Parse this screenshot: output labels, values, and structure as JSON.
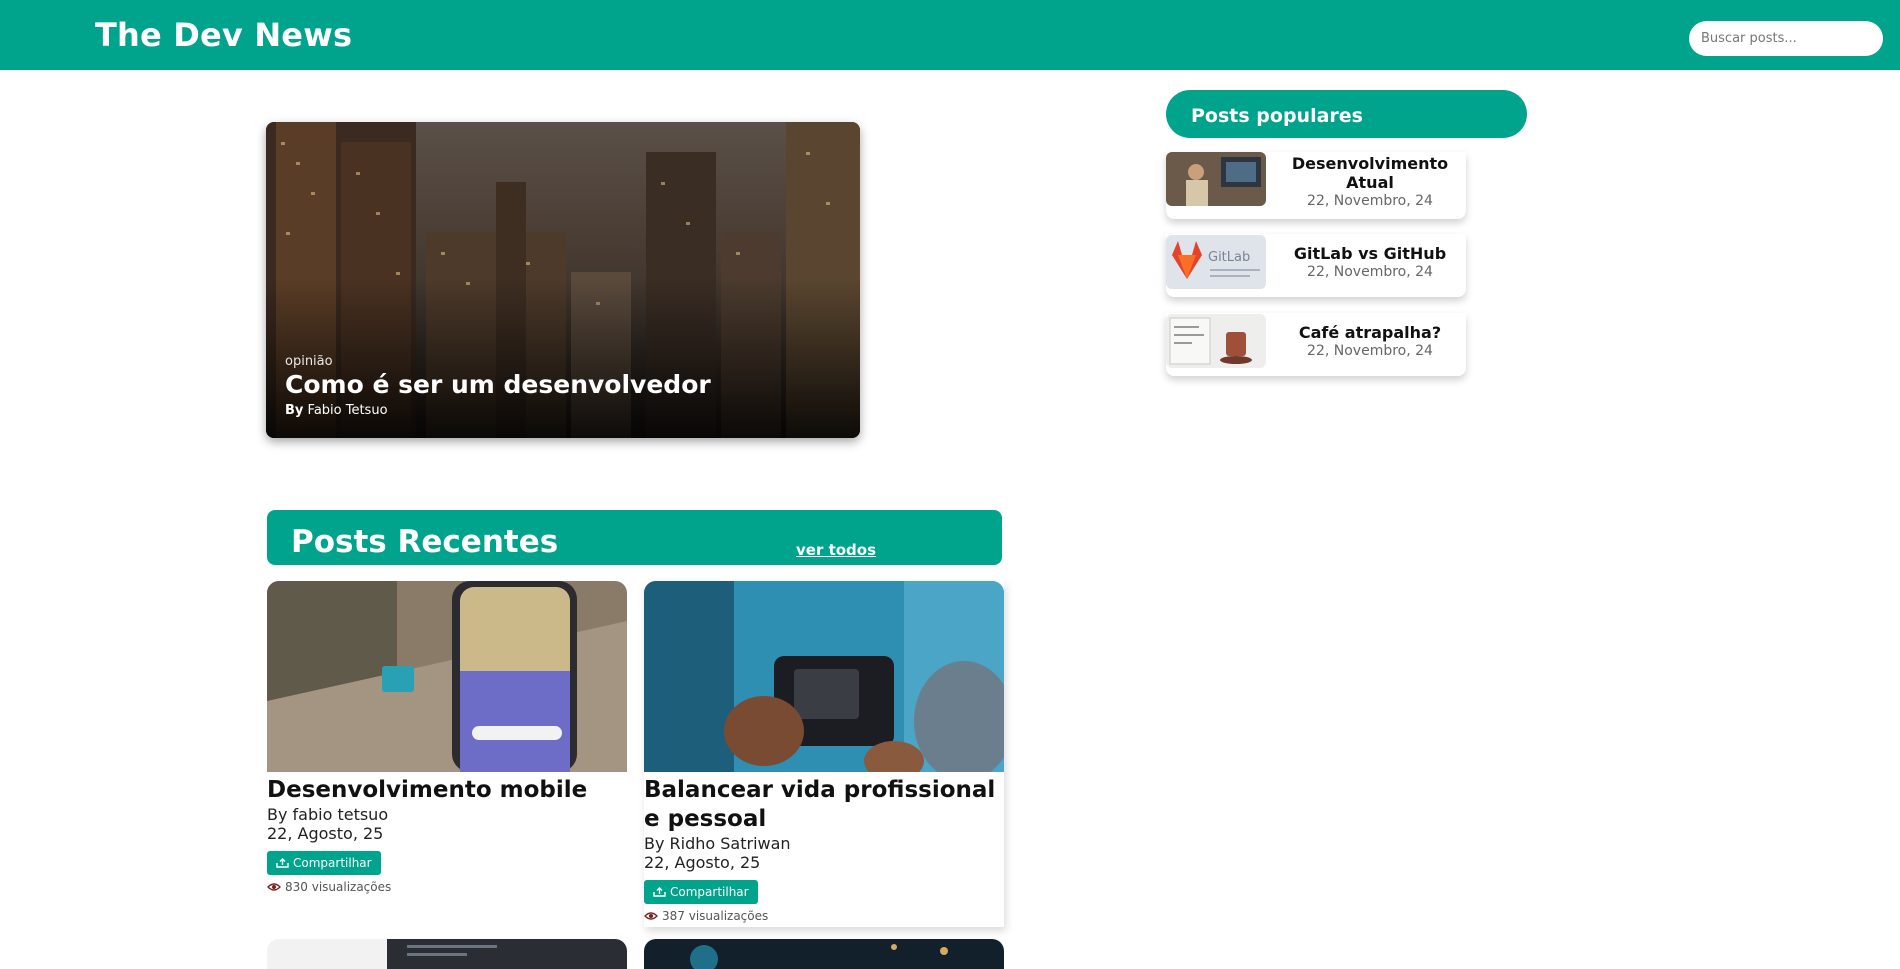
{
  "header": {
    "title": "The Dev News",
    "search_placeholder": "Buscar posts..."
  },
  "featured": {
    "category": "opinião",
    "title": "Como é ser um desenvolvedor",
    "author_prefix": "By",
    "author": "Fabio Tetsuo"
  },
  "recent": {
    "title": "Posts Recentes",
    "see_all": "ver todos",
    "posts": [
      {
        "title": "Desenvolvimento mobile",
        "author": "By fabio tetsuo",
        "date": "22, Agosto, 25",
        "share_label": "Compartilhar",
        "views": "830 visualizações"
      },
      {
        "title": "Balancear vida profissional e pessoal",
        "author": "By Ridho Satriwan",
        "date": "22, Agosto, 25",
        "share_label": "Compartilhar",
        "views": "387 visualizações"
      }
    ]
  },
  "popular": {
    "title": "Posts populares",
    "items": [
      {
        "title": "Desenvolvimento Atual",
        "date": "22, Novembro, 24"
      },
      {
        "title": "GitLab vs GitHub",
        "date": "22, Novembro, 24",
        "thumb_text": "GitLab"
      },
      {
        "title": "Café atrapalha?",
        "date": "22, Novembro, 24"
      }
    ]
  },
  "colors": {
    "brand": "#00a38c",
    "background": "#ffffff",
    "text": "#111111"
  },
  "icons": {
    "share": "share-tray-icon",
    "views": "eye-icon"
  }
}
